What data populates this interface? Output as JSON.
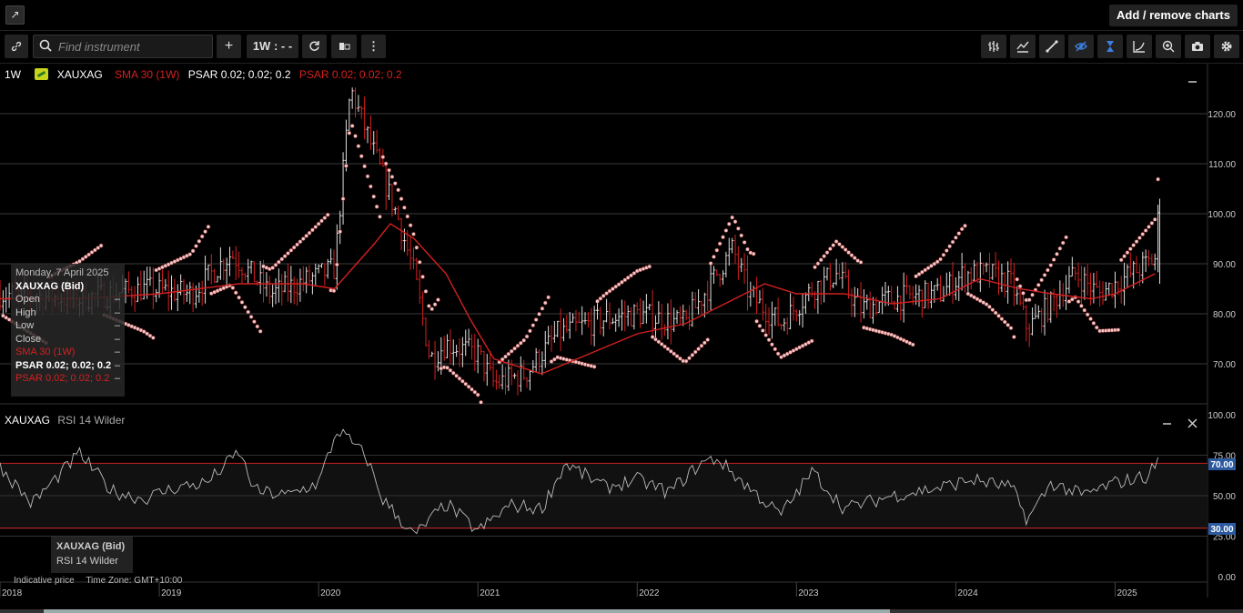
{
  "topbar": {
    "add_remove_label": "Add / remove charts"
  },
  "toolbar": {
    "search_placeholder": "Find instrument",
    "add_label": "+",
    "interval_label": "1W : - -",
    "icons": [
      "link-icon",
      "search-icon",
      "plus-icon",
      "refresh-icon",
      "chart-type-icon",
      "more-icon",
      "bar-chart-icon",
      "line-chart-icon",
      "draw-line-icon",
      "hide-icon",
      "crosshair-icon",
      "curve-icon",
      "zoom-icon",
      "camera-icon",
      "settings-icon"
    ]
  },
  "legend": {
    "interval": "1W",
    "symbol": "XAUXAG",
    "sma": "SMA 30 (1W)",
    "psar_white": "PSAR 0.02; 0.02; 0.2",
    "psar_red": "PSAR 0.02; 0.02; 0.2"
  },
  "tooltip": {
    "date": "Monday, 7 April 2025",
    "instrument": "XAUXAG (Bid)",
    "rows": [
      {
        "label": "Open",
        "value": "–"
      },
      {
        "label": "High",
        "value": "–"
      },
      {
        "label": "Low",
        "value": "–"
      },
      {
        "label": "Close",
        "value": "–"
      },
      {
        "label": "SMA 30 (1W)",
        "value": "–"
      },
      {
        "label": "PSAR 0.02; 0.02; 0.2",
        "value": "–"
      },
      {
        "label": "PSAR 0.02; 0.02; 0.2",
        "value": "–"
      }
    ]
  },
  "rsi_panel": {
    "symbol": "XAUXAG",
    "indicator": "RSI 14 Wilder",
    "tooltip_instrument": "XAUXAG (Bid)",
    "tooltip_indicator": "RSI 14 Wilder",
    "marker_70": "70.00",
    "marker_30": "30.00"
  },
  "footer": {
    "indicative": "Indicative price",
    "timezone": "Time Zone: GMT+10:00"
  },
  "colors": {
    "sma": "#d42020",
    "rsi_band": "#cc2222",
    "marker": "#2c5aa0",
    "psar_dot": "#f1c8c8"
  },
  "chart_data": [
    {
      "type": "candlestick",
      "title": "XAUXAG",
      "y_ticks": [
        "70.00",
        "80.00",
        "90.00",
        "100.00",
        "110.00",
        "120.00"
      ],
      "x_ticks": [
        "2018",
        "2019",
        "2020",
        "2021",
        "2022",
        "2023",
        "2024",
        "2025"
      ],
      "ylim": [
        62,
        130
      ],
      "xlim": [
        2018.0,
        2025.58
      ],
      "key_points": [
        {
          "x": 2018.0,
          "close": 84
        },
        {
          "x": 2018.5,
          "close": 83
        },
        {
          "x": 2018.9,
          "close": 85
        },
        {
          "x": 2019.2,
          "close": 84
        },
        {
          "x": 2019.45,
          "close": 92
        },
        {
          "x": 2019.7,
          "close": 84
        },
        {
          "x": 2019.95,
          "close": 87
        },
        {
          "x": 2020.1,
          "close": 89
        },
        {
          "x": 2020.2,
          "close": 125
        },
        {
          "x": 2020.35,
          "close": 112
        },
        {
          "x": 2020.5,
          "close": 99
        },
        {
          "x": 2020.6,
          "close": 88
        },
        {
          "x": 2020.7,
          "close": 71
        },
        {
          "x": 2020.8,
          "close": 74
        },
        {
          "x": 2021.0,
          "close": 72
        },
        {
          "x": 2021.1,
          "close": 66
        },
        {
          "x": 2021.3,
          "close": 68
        },
        {
          "x": 2021.5,
          "close": 76
        },
        {
          "x": 2021.8,
          "close": 79
        },
        {
          "x": 2022.0,
          "close": 80
        },
        {
          "x": 2022.3,
          "close": 78
        },
        {
          "x": 2022.5,
          "close": 88
        },
        {
          "x": 2022.6,
          "close": 93
        },
        {
          "x": 2022.7,
          "close": 84
        },
        {
          "x": 2022.9,
          "close": 78
        },
        {
          "x": 2023.1,
          "close": 85
        },
        {
          "x": 2023.25,
          "close": 88
        },
        {
          "x": 2023.4,
          "close": 81
        },
        {
          "x": 2023.6,
          "close": 83
        },
        {
          "x": 2023.9,
          "close": 84
        },
        {
          "x": 2024.05,
          "close": 88
        },
        {
          "x": 2024.2,
          "close": 88
        },
        {
          "x": 2024.35,
          "close": 86
        },
        {
          "x": 2024.45,
          "close": 77
        },
        {
          "x": 2024.6,
          "close": 82
        },
        {
          "x": 2024.75,
          "close": 88
        },
        {
          "x": 2024.9,
          "close": 84
        },
        {
          "x": 2025.0,
          "close": 86
        },
        {
          "x": 2025.15,
          "close": 89
        },
        {
          "x": 2025.25,
          "close": 91
        },
        {
          "x": 2025.28,
          "close": 103
        }
      ],
      "series": [
        {
          "name": "SMA 30 (1W)",
          "values": [
            {
              "x": 2018.0,
              "y": 83
            },
            {
              "x": 2018.5,
              "y": 83
            },
            {
              "x": 2019.0,
              "y": 84
            },
            {
              "x": 2019.5,
              "y": 86
            },
            {
              "x": 2019.9,
              "y": 86
            },
            {
              "x": 2020.1,
              "y": 85
            },
            {
              "x": 2020.35,
              "y": 94
            },
            {
              "x": 2020.45,
              "y": 98
            },
            {
              "x": 2020.6,
              "y": 95
            },
            {
              "x": 2020.8,
              "y": 88
            },
            {
              "x": 2020.95,
              "y": 79
            },
            {
              "x": 2021.1,
              "y": 71
            },
            {
              "x": 2021.4,
              "y": 68
            },
            {
              "x": 2021.7,
              "y": 72
            },
            {
              "x": 2022.0,
              "y": 76
            },
            {
              "x": 2022.3,
              "y": 78
            },
            {
              "x": 2022.55,
              "y": 82
            },
            {
              "x": 2022.8,
              "y": 86
            },
            {
              "x": 2023.0,
              "y": 84
            },
            {
              "x": 2023.3,
              "y": 84
            },
            {
              "x": 2023.6,
              "y": 82
            },
            {
              "x": 2023.9,
              "y": 83
            },
            {
              "x": 2024.15,
              "y": 87
            },
            {
              "x": 2024.4,
              "y": 85
            },
            {
              "x": 2024.6,
              "y": 84
            },
            {
              "x": 2024.85,
              "y": 83
            },
            {
              "x": 2025.0,
              "y": 84
            },
            {
              "x": 2025.25,
              "y": 88
            }
          ]
        }
      ]
    },
    {
      "type": "line",
      "title": "RSI 14 Wilder",
      "y_ticks": [
        "0.00",
        "25.00",
        "50.00",
        "75.00",
        "100.00"
      ],
      "ylim": [
        0,
        100
      ],
      "bands": [
        30,
        70
      ],
      "series": [
        {
          "name": "RSI 14 Wilder",
          "values": [
            {
              "x": 2018.0,
              "y": 68
            },
            {
              "x": 2018.2,
              "y": 45
            },
            {
              "x": 2018.5,
              "y": 76
            },
            {
              "x": 2018.7,
              "y": 53
            },
            {
              "x": 2018.9,
              "y": 48
            },
            {
              "x": 2019.1,
              "y": 55
            },
            {
              "x": 2019.3,
              "y": 58
            },
            {
              "x": 2019.5,
              "y": 77
            },
            {
              "x": 2019.6,
              "y": 53
            },
            {
              "x": 2019.8,
              "y": 50
            },
            {
              "x": 2020.0,
              "y": 58
            },
            {
              "x": 2020.12,
              "y": 91
            },
            {
              "x": 2020.3,
              "y": 74
            },
            {
              "x": 2020.4,
              "y": 48
            },
            {
              "x": 2020.5,
              "y": 37
            },
            {
              "x": 2020.6,
              "y": 25
            },
            {
              "x": 2020.8,
              "y": 45
            },
            {
              "x": 2021.0,
              "y": 28
            },
            {
              "x": 2021.2,
              "y": 44
            },
            {
              "x": 2021.4,
              "y": 42
            },
            {
              "x": 2021.55,
              "y": 70
            },
            {
              "x": 2021.8,
              "y": 55
            },
            {
              "x": 2022.0,
              "y": 60
            },
            {
              "x": 2022.2,
              "y": 52
            },
            {
              "x": 2022.4,
              "y": 70
            },
            {
              "x": 2022.5,
              "y": 73
            },
            {
              "x": 2022.7,
              "y": 55
            },
            {
              "x": 2022.9,
              "y": 38
            },
            {
              "x": 2023.1,
              "y": 65
            },
            {
              "x": 2023.3,
              "y": 42
            },
            {
              "x": 2023.6,
              "y": 50
            },
            {
              "x": 2023.9,
              "y": 55
            },
            {
              "x": 2024.1,
              "y": 60
            },
            {
              "x": 2024.35,
              "y": 55
            },
            {
              "x": 2024.45,
              "y": 35
            },
            {
              "x": 2024.6,
              "y": 58
            },
            {
              "x": 2024.8,
              "y": 50
            },
            {
              "x": 2025.0,
              "y": 58
            },
            {
              "x": 2025.2,
              "y": 62
            },
            {
              "x": 2025.28,
              "y": 73
            }
          ]
        }
      ]
    }
  ]
}
